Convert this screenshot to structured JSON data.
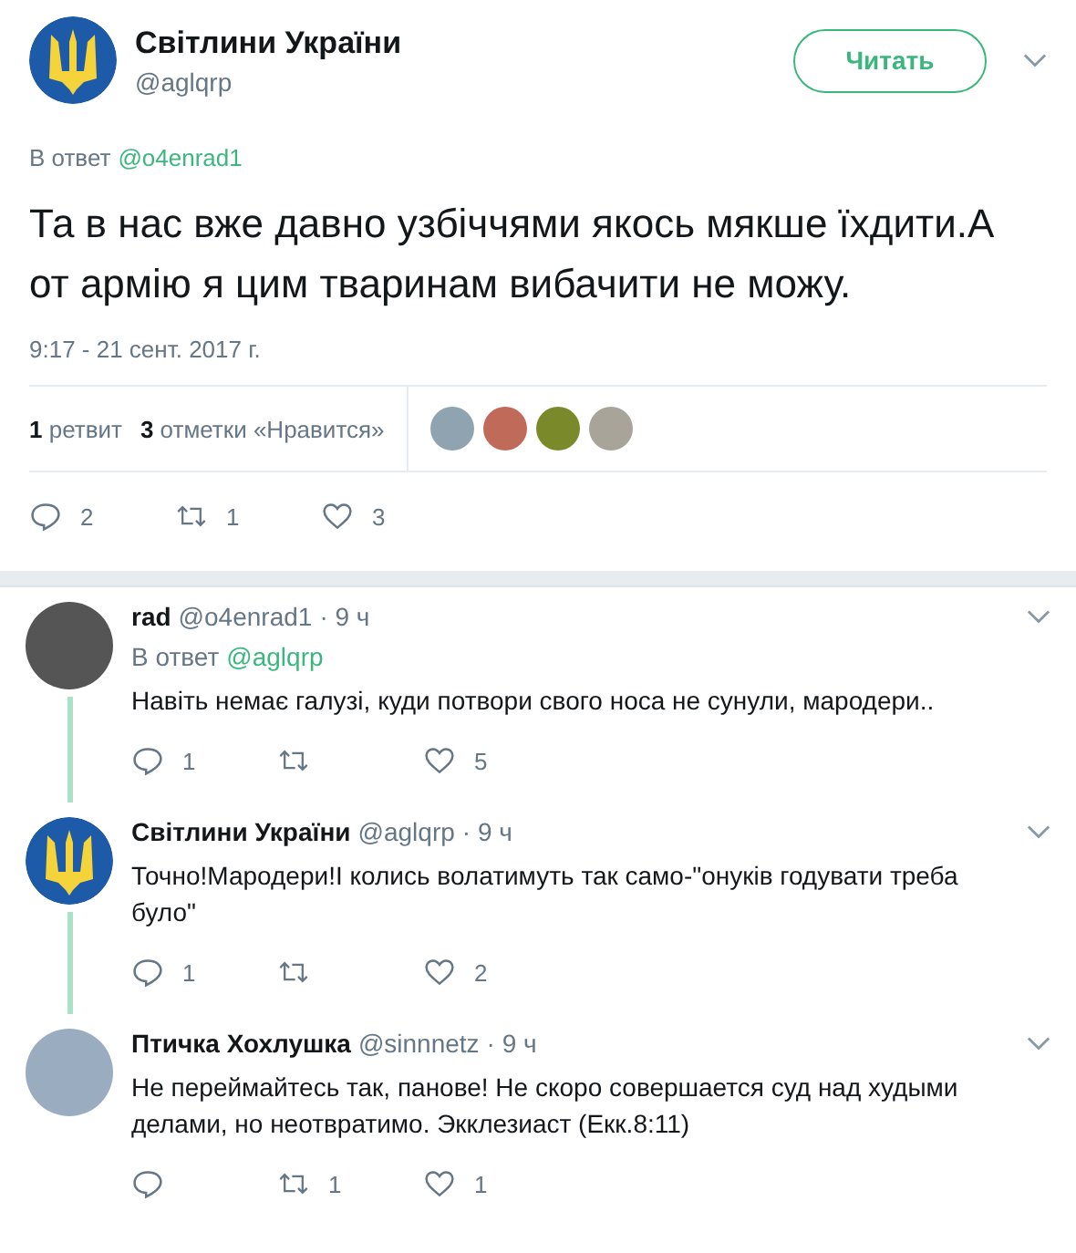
{
  "tweet": {
    "author": {
      "name": "Світлини України",
      "handle": "@aglqrp",
      "avatar": {
        "kind": "emblem"
      }
    },
    "follow_button": "Читать",
    "reply_to_label": "В ответ",
    "reply_to_handle": "@o4enrad1",
    "text": "Та в нас вже давно узбіччями якось мякше їхдити.А от армію я цим тваринам вибачити не можу.",
    "timestamp": "9:17 - 21 сент. 2017 г.",
    "stats": [
      {
        "count": "1",
        "label": "ретвит"
      },
      {
        "count": "3",
        "label": "отметки «Нравится»"
      }
    ],
    "likers": [
      {
        "color": "#8fa3b0"
      },
      {
        "color": "#c06a5a"
      },
      {
        "color": "#7a8a2a"
      },
      {
        "color": "#a8a49a"
      }
    ],
    "actions": {
      "replies": "2",
      "retweets": "1",
      "likes": "3"
    }
  },
  "replies": [
    {
      "name": "rad",
      "handle": "@o4enrad1",
      "time": "· 9 ч",
      "avatar": {
        "kind": "photo"
      },
      "reply_to_label": "В ответ",
      "reply_to_handle": "@aglqrp",
      "text": "Навіть немає галузі, куди потвори свого носа не сунули, мародери..",
      "thread_line": true,
      "actions": {
        "replies": "1",
        "likes": "5"
      }
    },
    {
      "name": "Світлини України",
      "handle": "@aglqrp",
      "time": "· 9 ч",
      "avatar": {
        "kind": "emblem"
      },
      "text": "Точно!Мародери!І колись волатимуть так само-\"онуків годувати треба було\"",
      "thread_line": true,
      "actions": {
        "replies": "1",
        "likes": "2"
      }
    },
    {
      "name": "Птичка Хохлушка",
      "handle": "@sinnnetz",
      "time": "· 9 ч",
      "avatar": {
        "kind": "bird"
      },
      "text": "Не переймайтесь так, панове! Не скоро совершается суд над худыми делами, но неотвратимо. Экклезиаст (Екк.8:11)",
      "thread_line": false,
      "actions": {
        "retweets": "1",
        "likes": "1"
      }
    }
  ]
}
